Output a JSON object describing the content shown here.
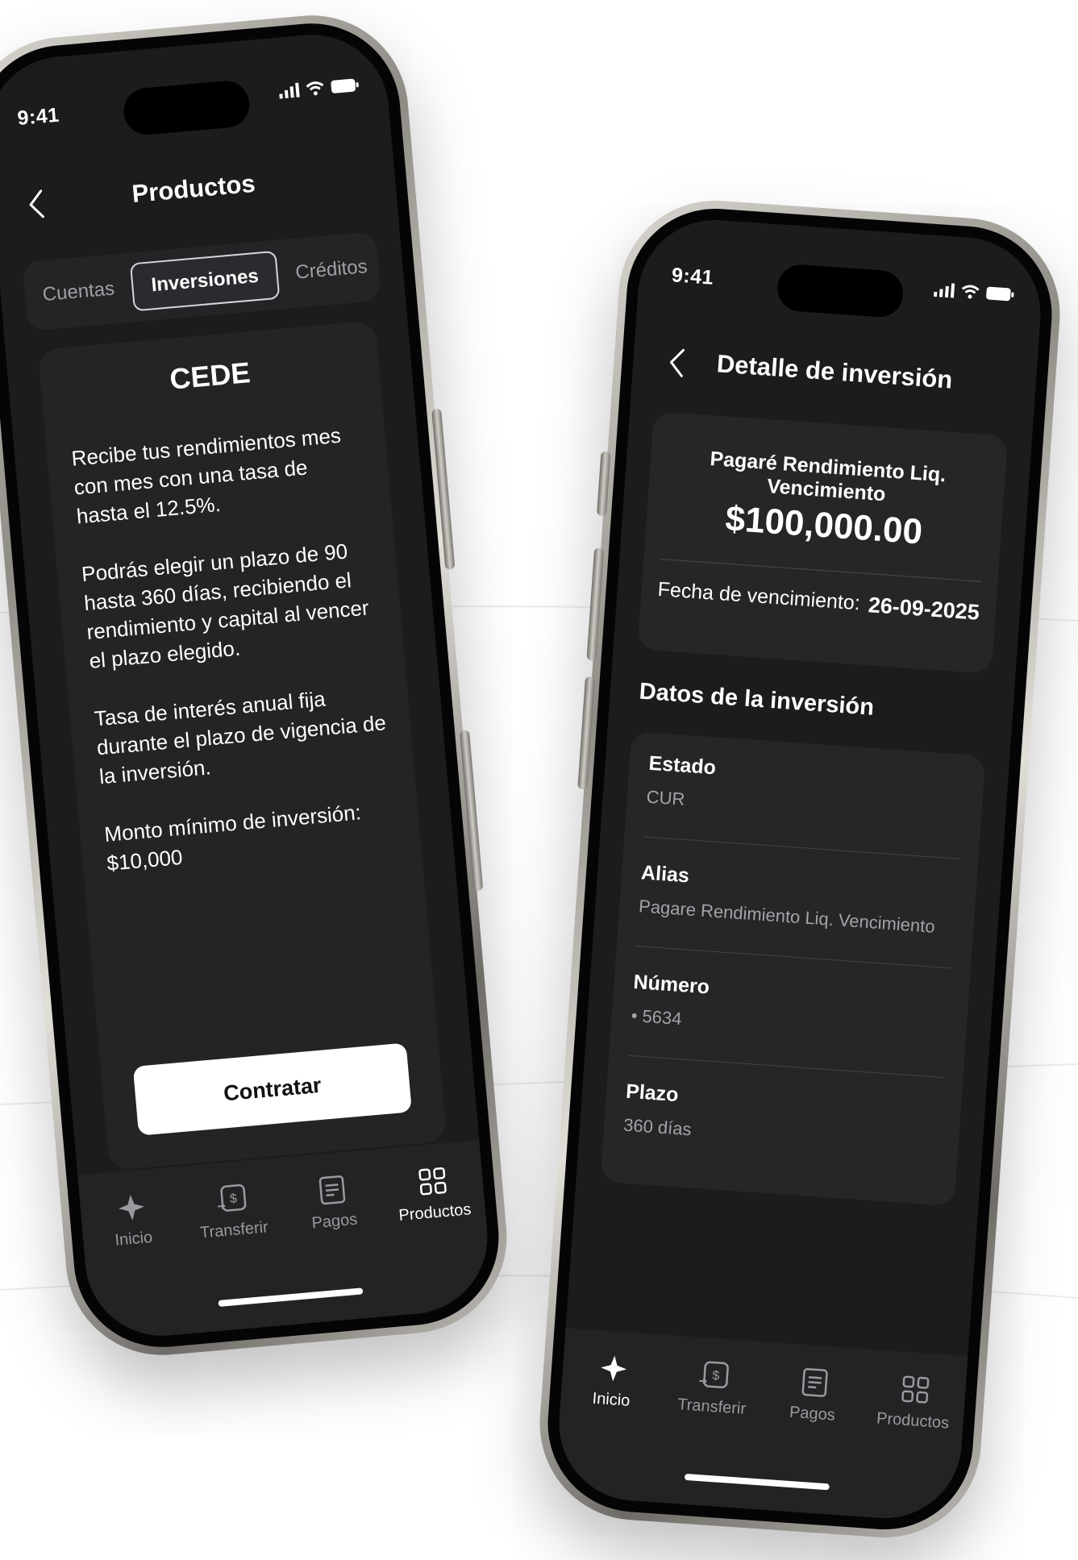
{
  "left_phone": {
    "time": "9:41",
    "header_title": "Productos",
    "segments": [
      "Cuentas",
      "Inversiones",
      "Créditos"
    ],
    "active_segment": "Inversiones",
    "card": {
      "title": "CEDE",
      "paragraphs": [
        "Recibe tus rendimientos mes con mes con una tasa de hasta el 12.5%.",
        "Podrás elegir un plazo de 90 hasta 360 días, recibiendo el rendimiento y capital al vencer el plazo elegido.",
        "Tasa de interés anual fija durante el plazo de vigencia de la inversión.",
        "Monto mínimo de inversión: $10,000"
      ],
      "button": "Contratar"
    },
    "tabs": [
      {
        "label": "Inicio",
        "icon": "home-star-icon"
      },
      {
        "label": "Transferir",
        "icon": "transfer-icon"
      },
      {
        "label": "Pagos",
        "icon": "receipt-icon"
      },
      {
        "label": "Productos",
        "icon": "grid-icon"
      }
    ],
    "active_tab": "Productos"
  },
  "right_phone": {
    "time": "9:41",
    "header_title": "Detalle de inversión",
    "investment": {
      "name": "Pagaré Rendimiento Liq. Vencimiento",
      "amount": "$100,000.00",
      "maturity_label": "Fecha de vencimiento:",
      "maturity_value": "26-09-2025"
    },
    "section_title": "Datos de la inversión",
    "fields": [
      {
        "label": "Estado",
        "value": "CUR"
      },
      {
        "label": "Alias",
        "value": "Pagare Rendimiento Liq. Vencimiento"
      },
      {
        "label": "Número",
        "value": "• 5634"
      },
      {
        "label": "Plazo",
        "value": "360 días"
      }
    ],
    "tabs": [
      {
        "label": "Inicio",
        "icon": "home-star-icon"
      },
      {
        "label": "Transferir",
        "icon": "transfer-icon"
      },
      {
        "label": "Pagos",
        "icon": "receipt-icon"
      },
      {
        "label": "Productos",
        "icon": "grid-icon"
      }
    ],
    "active_tab": "Inicio"
  },
  "colors": {
    "screen_bg": "#1c1c1e",
    "card_bg": "#242426",
    "text": "#ffffff",
    "muted": "#a0a0a4",
    "button_bg": "#ffffff"
  }
}
